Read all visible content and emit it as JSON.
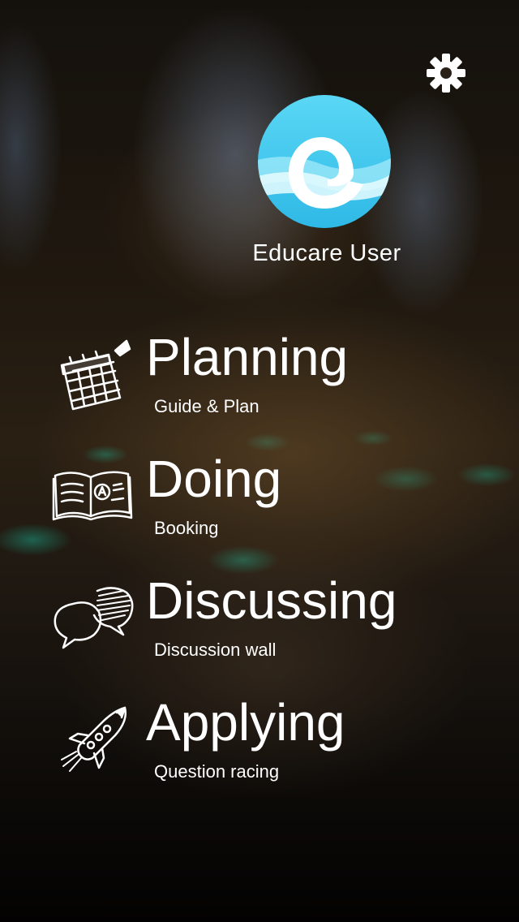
{
  "user": {
    "name": "Educare User"
  },
  "menu": [
    {
      "title": "Planning",
      "subtitle": "Guide & Plan",
      "icon": "calendar-icon"
    },
    {
      "title": "Doing",
      "subtitle": "Booking",
      "icon": "open-book-icon"
    },
    {
      "title": "Discussing",
      "subtitle": "Discussion wall",
      "icon": "speech-bubbles-icon"
    },
    {
      "title": "Applying",
      "subtitle": "Question racing",
      "icon": "rocket-icon"
    }
  ],
  "colors": {
    "logo_light": "#e8fbff",
    "logo_accent": "#38c8ee",
    "text": "#ffffff"
  }
}
